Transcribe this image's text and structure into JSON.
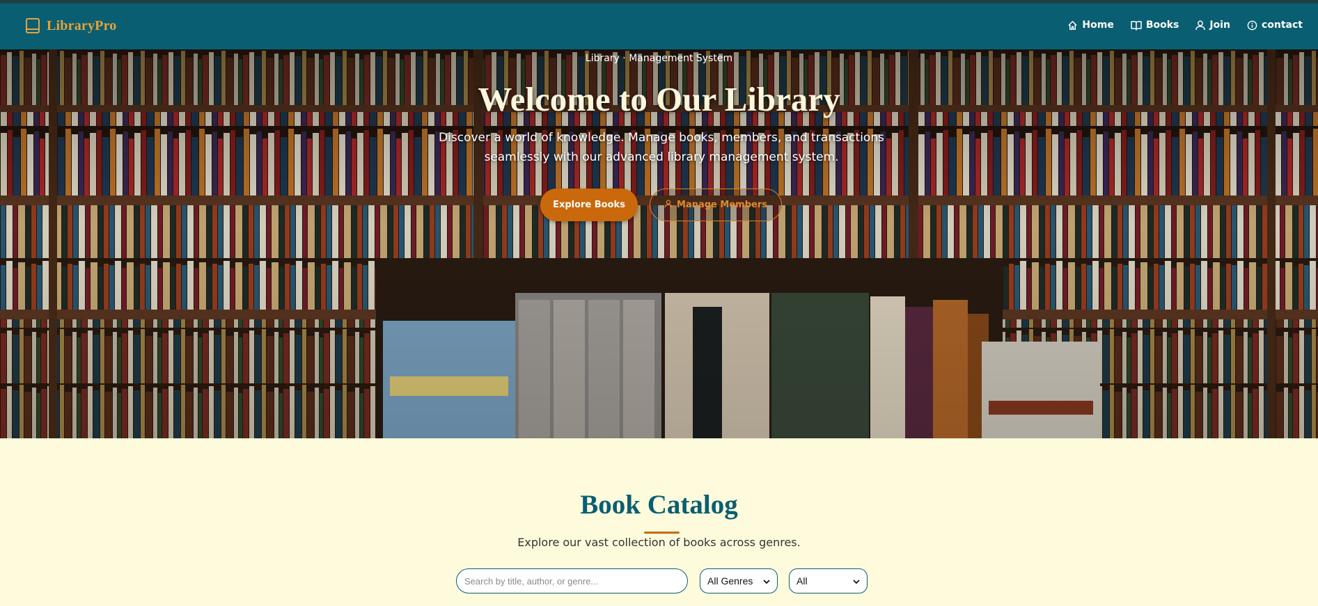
{
  "brand": {
    "name": "LibraryPro",
    "icon": "book-icon",
    "accent": "#e8a23a"
  },
  "nav": [
    {
      "label": "Home",
      "icon": "home-icon"
    },
    {
      "label": "Books",
      "icon": "book-open-icon"
    },
    {
      "label": "Join",
      "icon": "user-icon"
    },
    {
      "label": "contact",
      "icon": "info-icon"
    }
  ],
  "hero": {
    "tag": "Library · Management System",
    "title": "Welcome to Our Library",
    "subtitle": "Discover a world of knowledge. Manage books, members, and transactions seamlessly with our advanced library management system.",
    "primary_button": "Explore Books",
    "secondary_button": "Manage Members"
  },
  "catalog": {
    "title": "Book Catalog",
    "subtitle": "Explore our vast collection of books across genres.",
    "search_placeholder": "Search by title, author, or genre...",
    "genre_select": "All Genres",
    "availability_select": "All"
  },
  "colors": {
    "navbar": "#0a5e72",
    "accent": "#c9690c",
    "page_bg": "#fdfbdc"
  }
}
